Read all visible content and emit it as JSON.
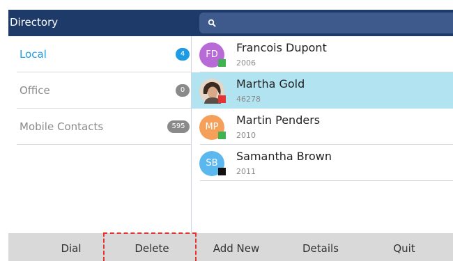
{
  "header": {
    "title": "Directory",
    "search_icon": "magnifier"
  },
  "sidebar": {
    "items": [
      {
        "label": "Local",
        "count": "4",
        "active": true
      },
      {
        "label": "Office",
        "count": "0",
        "active": false
      },
      {
        "label": "Mobile Contacts",
        "count": "595",
        "active": false
      }
    ]
  },
  "contacts": [
    {
      "initials": "FD",
      "name": "Francois Dupont",
      "number": "2006",
      "avatar_color": "#b86ad6",
      "status_color": "#3fb34f",
      "selected": false
    },
    {
      "initials": "",
      "name": "Martha Gold",
      "number": "46278",
      "avatar_color": "photo",
      "status_color": "#e53333",
      "selected": true
    },
    {
      "initials": "MP",
      "name": "Martin Penders",
      "number": "2010",
      "avatar_color": "#f5a05a",
      "status_color": "#3fb34f",
      "selected": false
    },
    {
      "initials": "SB",
      "name": "Samantha Brown",
      "number": "2011",
      "avatar_color": "#5bb8ef",
      "status_color": "#111111",
      "selected": false
    }
  ],
  "softkeys": {
    "dial": "Dial",
    "delete": "Delete",
    "add_new": "Add New",
    "details": "Details",
    "quit": "Quit"
  },
  "colors": {
    "header_bg": "#1d3a68",
    "search_bg": "#3e5a8c",
    "accent": "#1e9be3",
    "selected_row": "#b1e3f1",
    "softkey_bar": "#d9d9d9",
    "highlight_dash": "#e53333"
  }
}
